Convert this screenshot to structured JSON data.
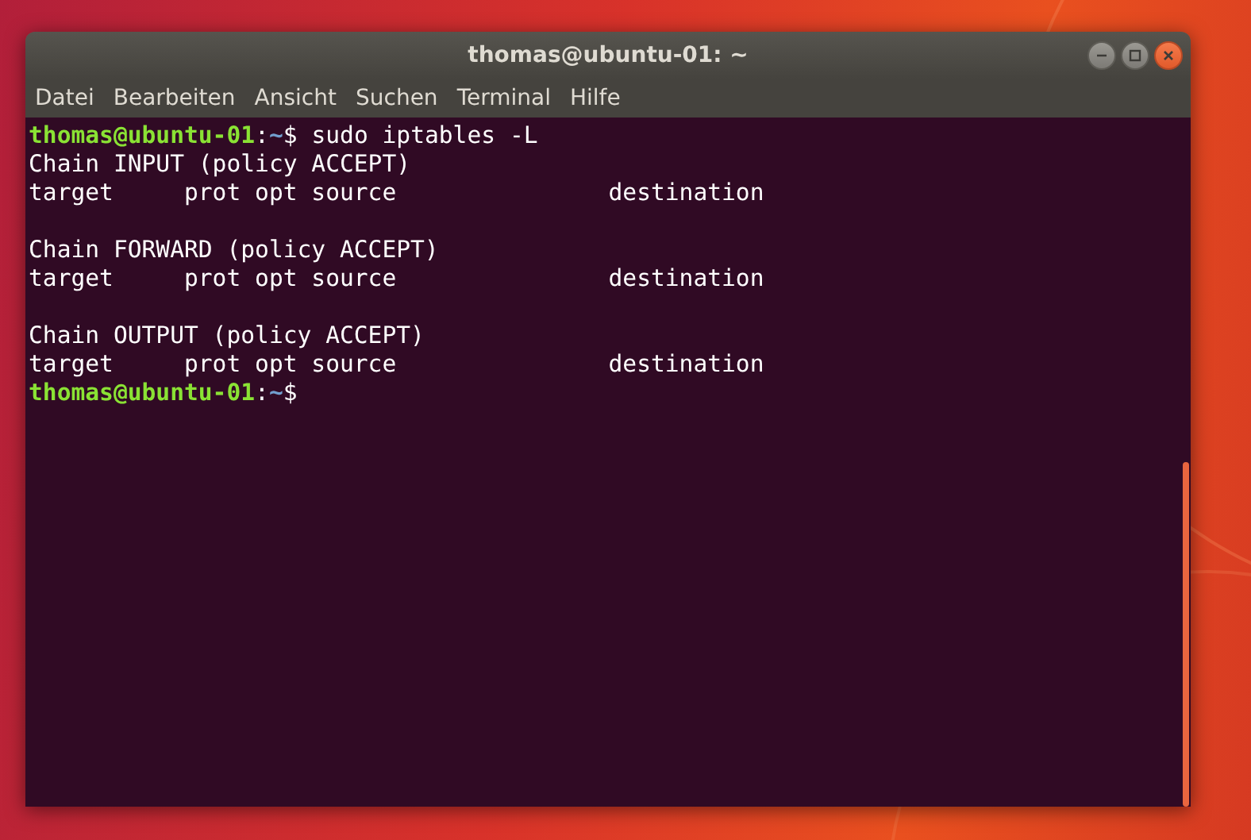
{
  "window": {
    "title": "thomas@ubuntu-01: ~"
  },
  "menu": [
    "Datei",
    "Bearbeiten",
    "Ansicht",
    "Suchen",
    "Terminal",
    "Hilfe"
  ],
  "terminal": {
    "lines": [
      {
        "kind": "prompt",
        "user": "thomas@ubuntu-01",
        "sep": ":",
        "path": "~",
        "symbol": "$",
        "command": " sudo iptables -L"
      },
      {
        "kind": "output",
        "text": "Chain INPUT (policy ACCEPT)"
      },
      {
        "kind": "output",
        "text": "target     prot opt source               destination"
      },
      {
        "kind": "blank"
      },
      {
        "kind": "output",
        "text": "Chain FORWARD (policy ACCEPT)"
      },
      {
        "kind": "output",
        "text": "target     prot opt source               destination"
      },
      {
        "kind": "blank"
      },
      {
        "kind": "output",
        "text": "Chain OUTPUT (policy ACCEPT)"
      },
      {
        "kind": "output",
        "text": "target     prot opt source               destination"
      },
      {
        "kind": "prompt",
        "user": "thomas@ubuntu-01",
        "sep": ":",
        "path": "~",
        "symbol": "$"
      }
    ]
  }
}
